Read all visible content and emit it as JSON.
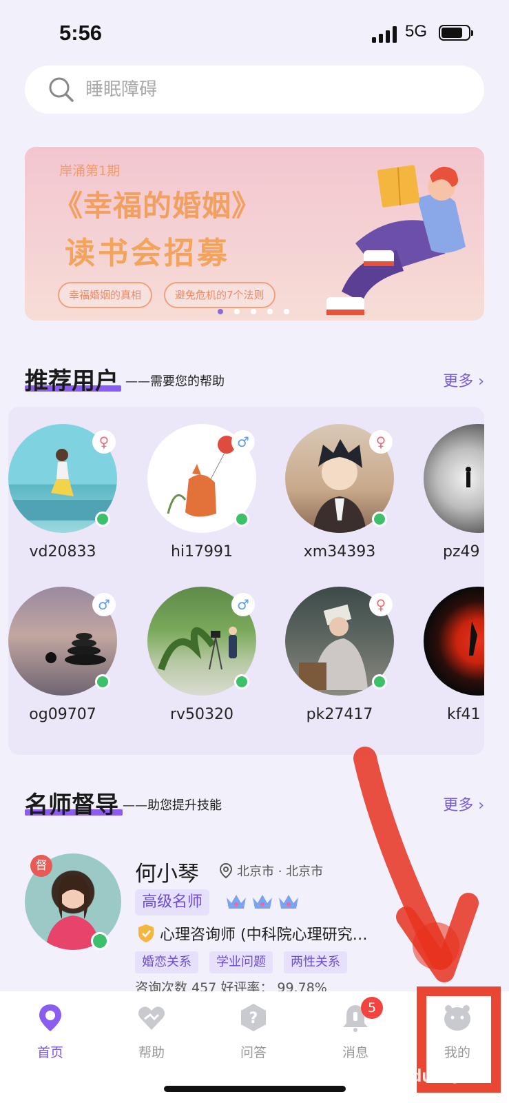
{
  "status": {
    "time": "5:56",
    "network": "5G"
  },
  "search": {
    "placeholder": "睡眠障碍"
  },
  "banner": {
    "episode": "岸涌第1期",
    "title": "《幸福的婚姻》",
    "subtitle": "读书会招募",
    "tags": [
      "幸福婚姻的真相",
      "避免危机的7个法则"
    ]
  },
  "recommend": {
    "title": "推荐用户",
    "subtitle": "——需要您的帮助",
    "more": "更多",
    "users": [
      {
        "name": "vd20833",
        "gender": "female"
      },
      {
        "name": "hi17991",
        "gender": "male"
      },
      {
        "name": "xm34393",
        "gender": "female"
      },
      {
        "name": "pz49",
        "gender": ""
      },
      {
        "name": "og09707",
        "gender": "male"
      },
      {
        "name": "rv50320",
        "gender": "male"
      },
      {
        "name": "pk27417",
        "gender": "female"
      },
      {
        "name": "kf41",
        "gender": ""
      }
    ]
  },
  "mentors": {
    "title": "名师督导",
    "subtitle": "——助您提升技能",
    "more": "更多",
    "item": {
      "badge": "督",
      "name": "何小琴",
      "location": "北京市 · 北京市",
      "level": "高级名师",
      "cert": "心理咨询师 (中科院心理研究…",
      "tags": [
        "婚恋关系",
        "学业问题",
        "两性关系"
      ],
      "stats": "咨询次数 457      好评率： 99.78%"
    }
  },
  "tabs": [
    {
      "label": "首页",
      "icon": "home-icon"
    },
    {
      "label": "帮助",
      "icon": "help-heart-icon"
    },
    {
      "label": "问答",
      "icon": "question-icon"
    },
    {
      "label": "消息",
      "icon": "bell-icon",
      "badge": "5"
    },
    {
      "label": "我的",
      "icon": "profile-icon"
    }
  ],
  "watermark": "Baidu经验",
  "colors": {
    "accent": "#7a55e8",
    "online": "#3cc16a",
    "badge": "#f1443e",
    "annotation": "#e8321e"
  }
}
